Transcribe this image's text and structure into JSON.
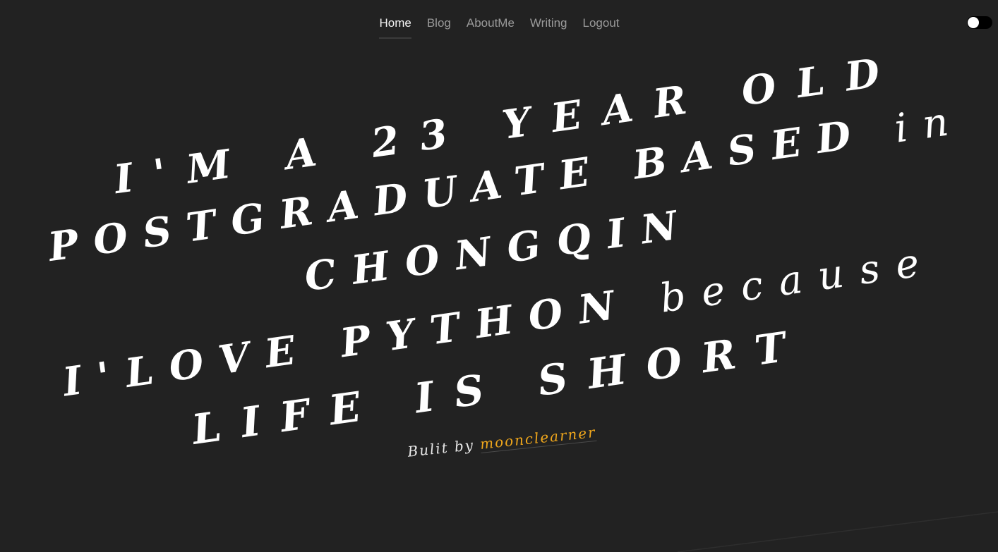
{
  "nav": {
    "items": [
      {
        "label": "Home",
        "active": true
      },
      {
        "label": "Blog",
        "active": false
      },
      {
        "label": "AboutMe",
        "active": false
      },
      {
        "label": "Writing",
        "active": false
      },
      {
        "label": "Logout",
        "active": false
      }
    ]
  },
  "theme_toggle": {
    "state": "off"
  },
  "hero": {
    "line1": "I'M A 23 YEAR OLD",
    "line2_main": "POSTGRADUATE BASED ",
    "line2_tail": "in",
    "line3": "CHONGQIN",
    "line4_main": "I'LOVE PYTHON ",
    "line4_tail": "because",
    "line5": "LIFE IS SHORT"
  },
  "credit": {
    "prefix": "Bulit by ",
    "author": "moonclearner"
  },
  "colors": {
    "background": "#222222",
    "text": "#ffffff",
    "accent": "#f0a71c",
    "nav_inactive": "#9a9a9a"
  }
}
